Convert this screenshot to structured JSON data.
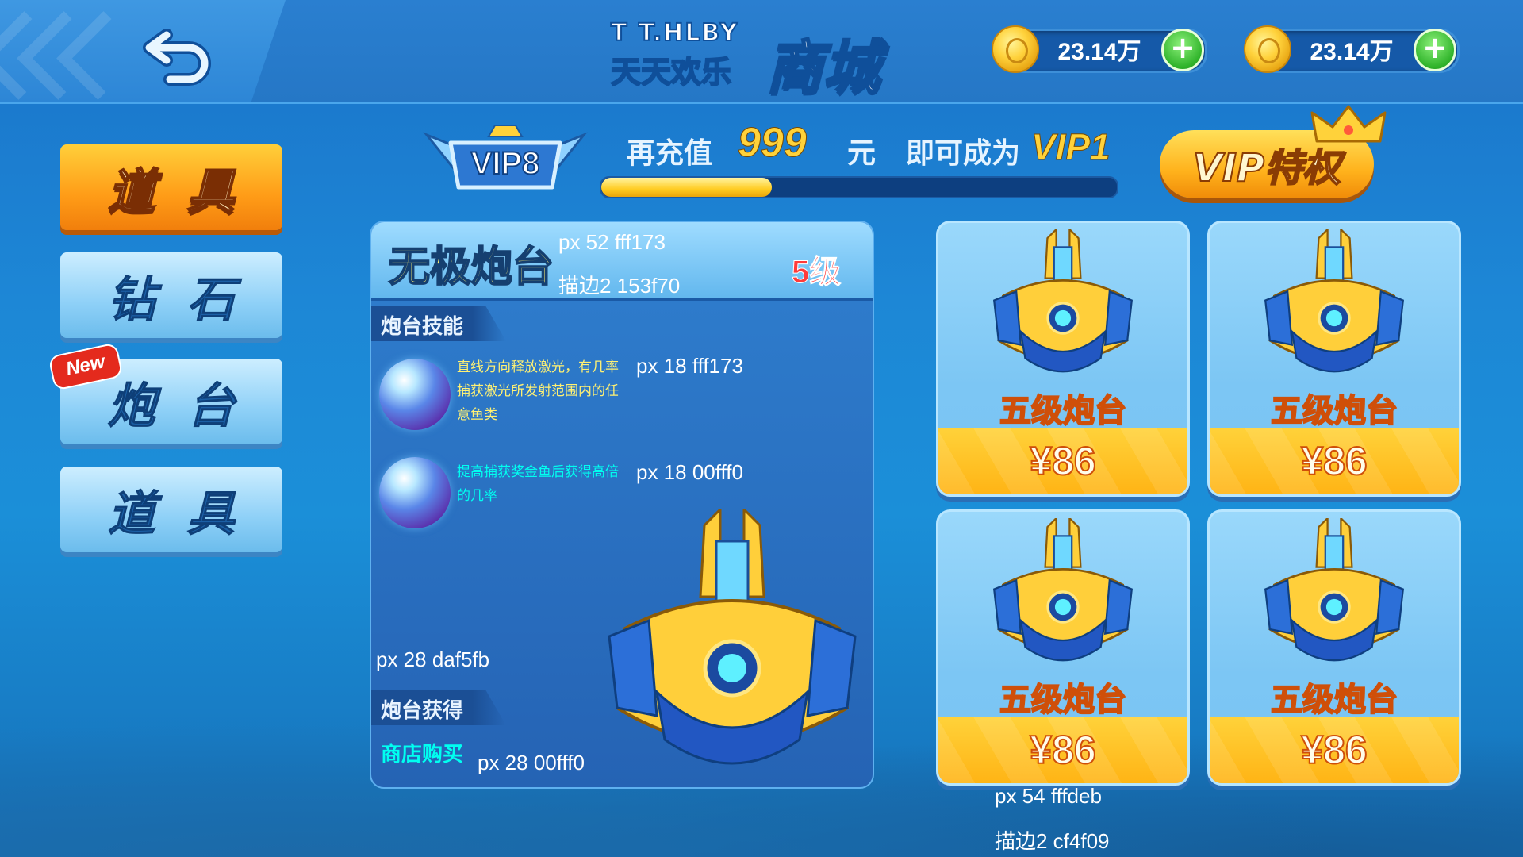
{
  "colors": {
    "accent_orange": "#ff9c17",
    "panel_blue": "#2563b4",
    "title_yellow": "#fff173",
    "title_stroke": "#153f70",
    "skill1_text": "#fff173",
    "skill2_text": "#00fff0",
    "obtain_text": "#00fff0",
    "card_text": "#fffdeb",
    "card_stroke": "#cf4f09",
    "level_red": "#ff3b3b"
  },
  "header": {
    "back_icon": "back-arrow-icon",
    "logo_line1": "T T.HLBY",
    "logo_line2": "天天欢乐",
    "title": "商城",
    "currencies": [
      {
        "icon": "gold-coin-icon",
        "value": "23.14万",
        "add_icon": "plus-icon"
      },
      {
        "icon": "gold-coin-icon",
        "value": "23.14万",
        "add_icon": "plus-icon"
      }
    ]
  },
  "sidebar": {
    "items": [
      {
        "label": "道具",
        "active": true
      },
      {
        "label": "钻石",
        "active": false
      },
      {
        "label": "炮台",
        "active": false,
        "badge": "New"
      },
      {
        "label": "道具",
        "active": false
      }
    ]
  },
  "vip": {
    "current_level": "VIP8",
    "recharge_prefix": "再充值",
    "recharge_amount": "999",
    "recharge_unit": "元",
    "become_text": "即可成为",
    "next_level": "VIP1",
    "progress": 0.33,
    "privilege_button": "VIP特权"
  },
  "detail": {
    "title": "无极炮台",
    "note_title_font": "px 52 fff173",
    "note_title_stroke": "描边2 153f70",
    "level": "5级",
    "skills_header": "炮台技能",
    "skills": [
      {
        "icon": "skill-orb-icon",
        "desc": "直线方向释放激光，有几率捕获激光所发射范围内的任意鱼类",
        "note": "px 18 fff173"
      },
      {
        "icon": "skill-orb-icon",
        "desc": "提高捕获奖金鱼后获得高倍的几率",
        "note": "px 18 00fff0"
      }
    ],
    "note_section_font": "px 28 daf5fb",
    "obtain_header": "炮台获得",
    "obtain_text": "商店购买",
    "note_obtain_font": "px 28 00fff0"
  },
  "products": [
    {
      "name": "五级炮台",
      "price": "¥86"
    },
    {
      "name": "五级炮台",
      "price": "¥86"
    },
    {
      "name": "五级炮台",
      "price": "¥86"
    },
    {
      "name": "五级炮台",
      "price": "¥86"
    }
  ],
  "product_notes": {
    "font": "px 54 fffdeb",
    "stroke": "描边2 cf4f09"
  }
}
